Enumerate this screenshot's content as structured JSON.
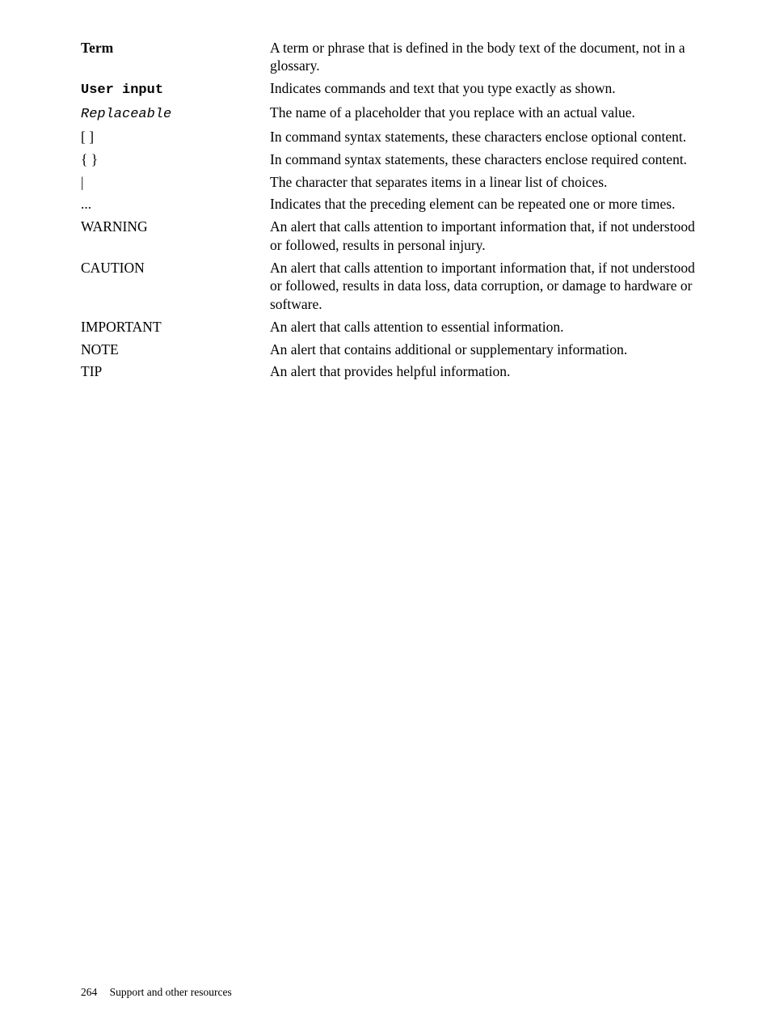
{
  "rows": [
    {
      "term": "Term",
      "termClass": "bold",
      "desc": "A term or phrase that is defined in the body text of the document, not in a glossary."
    },
    {
      "term": "User input",
      "termClass": "mono-bold",
      "desc": "Indicates commands and text that you type exactly as shown."
    },
    {
      "term": "Replaceable",
      "termClass": "mono-italic",
      "desc": "The name of a placeholder that you replace with an actual value."
    },
    {
      "term": "[ ]",
      "termClass": "",
      "desc": "In command syntax statements, these characters enclose optional content."
    },
    {
      "term": "{ }",
      "termClass": "",
      "desc": "In command syntax statements, these characters enclose required content."
    },
    {
      "term": "|",
      "termClass": "",
      "desc": "The character that separates items in a linear list of choices."
    },
    {
      "term": "...",
      "termClass": "",
      "desc": "Indicates that the preceding element can be repeated one or more times."
    },
    {
      "term": "WARNING",
      "termClass": "",
      "desc": "An alert that calls attention to important information that, if not understood or followed, results in personal injury."
    },
    {
      "term": "CAUTION",
      "termClass": "",
      "desc": "An alert that calls attention to important information that, if not understood or followed, results in data loss, data corruption, or damage to hardware or software."
    },
    {
      "term": "IMPORTANT",
      "termClass": "",
      "desc": "An alert that calls attention to essential information."
    },
    {
      "term": "NOTE",
      "termClass": "",
      "desc": "An alert that contains additional or supplementary information."
    },
    {
      "term": "TIP",
      "termClass": "",
      "desc": "An alert that provides helpful information."
    }
  ],
  "footer": {
    "page_number": "264",
    "section": "Support and other resources"
  }
}
